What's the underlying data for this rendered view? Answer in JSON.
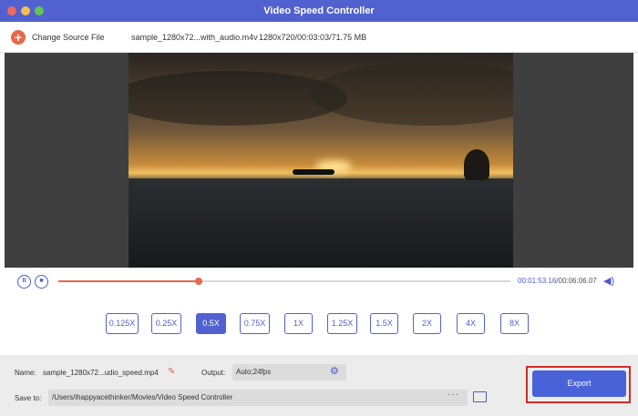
{
  "window": {
    "title": "Video Speed Controller"
  },
  "source": {
    "change_label": "Change Source File",
    "file_name": "sample_1280x72...with_audio.m4v",
    "file_info": "1280x720/00:03:03/71.75 MB"
  },
  "playback": {
    "current_time": "00:01:53.16",
    "total_time": "/00:06:06.07",
    "progress": 0.31
  },
  "speeds": {
    "options": [
      "0.125X",
      "0.25X",
      "0.5X",
      "0.75X",
      "1X",
      "1.25X",
      "1.5X",
      "2X",
      "4X",
      "8X"
    ],
    "selected": "0.5X"
  },
  "output": {
    "name_label": "Name:",
    "name_value": "sample_1280x72...udio_speed.mp4",
    "output_label": "Output:",
    "output_value": "Auto;24fps",
    "save_label": "Save to:",
    "save_path": "/Users/ihappyacethinker/Movies/Video Speed Controller",
    "more_label": "···",
    "export_label": "Export"
  },
  "icons": {
    "add": "plus-circle-icon",
    "play": "pause-icon",
    "stop": "stop-icon",
    "volume": "volume-icon",
    "edit": "pencil-icon",
    "settings": "gear-icon",
    "folder": "folder-icon"
  },
  "colors": {
    "accent": "#5161cf",
    "orange": "#e8674a",
    "highlight": "#d42a2a"
  }
}
